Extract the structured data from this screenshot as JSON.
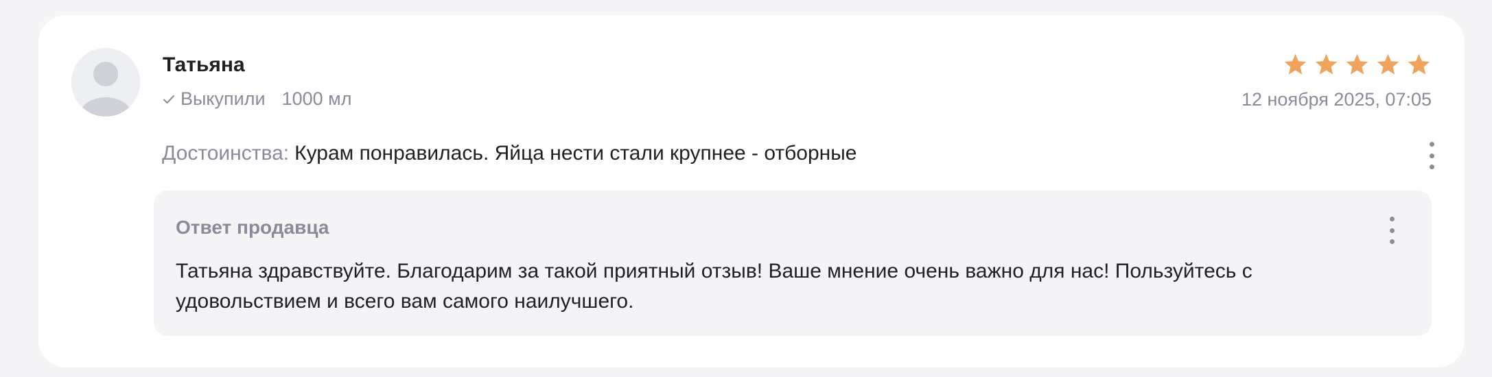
{
  "review": {
    "author": "Татьяна",
    "verified_label": "Выкупили",
    "variant": "1000 мл",
    "date": "12 ноября 2025, 07:05",
    "rating": 5,
    "rating_max": 5,
    "pros_label": "Достоинства:",
    "pros_text": "Курам понравилась. Яйца нести стали крупнее - отборные",
    "icons": {
      "avatar": "user-avatar-placeholder-icon",
      "verified": "check-icon",
      "star": "star-icon",
      "menu": "more-vertical-icon"
    }
  },
  "seller_reply": {
    "title": "Ответ продавца",
    "text": "Татьяна здравствуйте. Благодарим за такой приятный отзыв! Ваше мнение очень важно для нас! Пользуйтесь с удовольствием и всего вам самого наилучшего."
  },
  "colors": {
    "star": "#f0a35c",
    "secondary_text": "#8a8a99",
    "primary_text": "#1f1f24",
    "reply_background": "#f4f4f6"
  }
}
